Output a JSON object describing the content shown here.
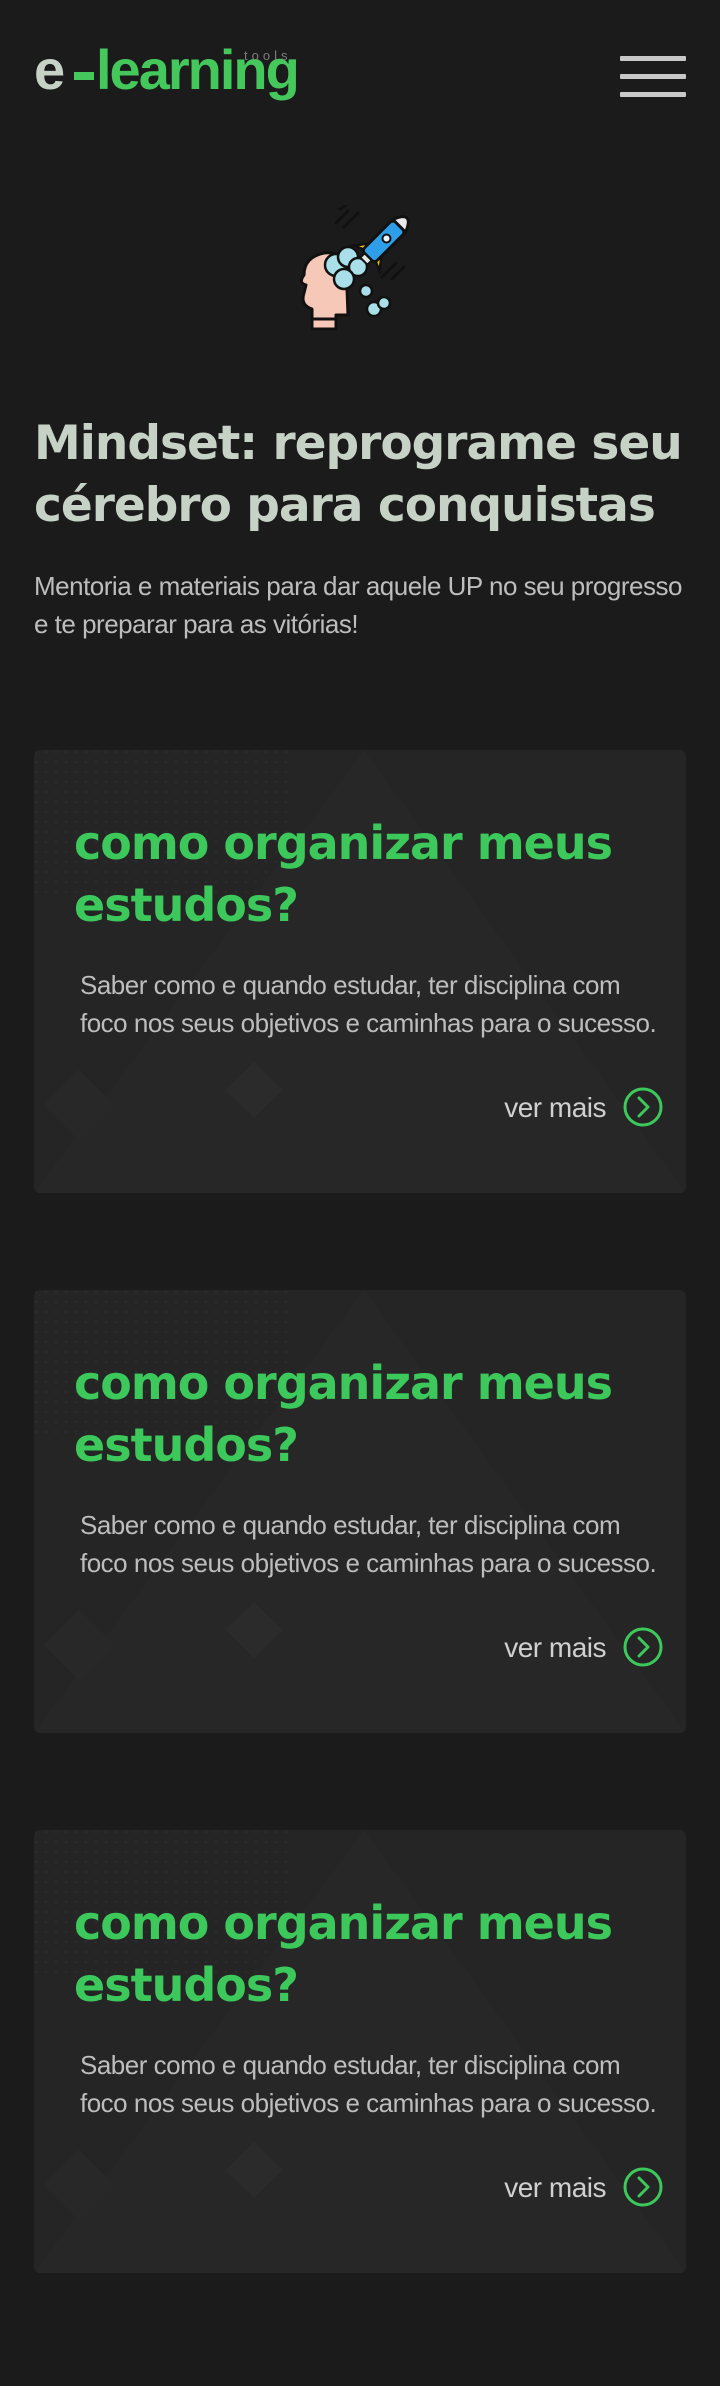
{
  "header": {
    "logo_e": "e",
    "logo_learning": "learning",
    "logo_tools": "tools",
    "menu_icon": "hamburger-icon"
  },
  "hero": {
    "icon": "mind-rocket-icon",
    "title": "Mindset: reprograme seu cérebro para conquistas",
    "subtitle": "Mentoria e materiais para dar aquele UP no seu progresso e te preparar para as vitórias!"
  },
  "cards": [
    {
      "title": "como organizar meus estudos?",
      "description": "Saber como e quando estudar, ter disciplina com foco nos seus objetivos e caminhas para o sucesso.",
      "link_label": "ver mais",
      "link_icon": "chevron-right-circle-icon"
    },
    {
      "title": "como organizar meus estudos?",
      "description": "Saber como e quando estudar, ter disciplina com foco nos seus objetivos e caminhas para o sucesso.",
      "link_label": "ver mais",
      "link_icon": "chevron-right-circle-icon"
    },
    {
      "title": "como organizar meus estudos?",
      "description": "Saber como e quando estudar, ter disciplina com foco nos seus objetivos e caminhas para o sucesso.",
      "link_label": "ver mais",
      "link_icon": "chevron-right-circle-icon"
    }
  ],
  "colors": {
    "background": "#1b1b1b",
    "card": "#252525",
    "accent_green": "#3cc85a",
    "heading_light": "#c7d2c6",
    "text": "#bdbdbd"
  }
}
